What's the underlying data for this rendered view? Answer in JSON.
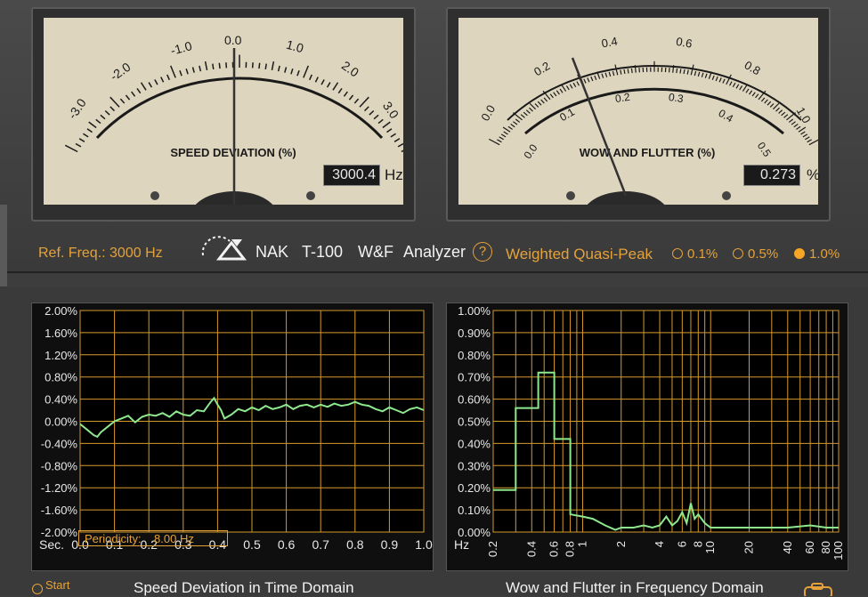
{
  "meters": {
    "speed": {
      "title": "SPEED DEVIATION (%)",
      "scale": [
        "-3.0",
        "-2.0",
        "-1.0",
        "0.0",
        "1.0",
        "2.0",
        "3.0"
      ],
      "readout": "3000.4",
      "unit": "Hz"
    },
    "wow": {
      "title": "WOW AND FLUTTER (%)",
      "outer_scale": [
        "0.0",
        "0.2",
        "0.4",
        "0.6",
        "0.8",
        "1.0"
      ],
      "inner_scale": [
        "0.0",
        "0.1",
        "0.2",
        "0.3",
        "0.4",
        "0.5"
      ],
      "readout": "0.273",
      "unit": "%"
    }
  },
  "control_bar": {
    "ref_freq": "Ref. Freq.: 3000 Hz",
    "brand_nak": "NAK",
    "brand_model": "T-100",
    "brand_wf": "W&F",
    "brand_analyzer": "Analyzer",
    "help": "?",
    "mode": "Weighted Quasi-Peak",
    "ranges": [
      {
        "label": "0.1%",
        "selected": false
      },
      {
        "label": "0.5%",
        "selected": false
      },
      {
        "label": "1.0%",
        "selected": true
      }
    ]
  },
  "bottom": {
    "start_label": "Start",
    "left_caption": "Speed Deviation in Time Domain",
    "right_caption": "Wow and Flutter in Frequency Domain",
    "periodicity_label": "Periodicity:",
    "periodicity_value": "8.00 Hz"
  },
  "chart_data": [
    {
      "type": "line",
      "y_ticks": [
        "2.00%",
        "1.60%",
        "1.20%",
        "0.80%",
        "0.40%",
        "0.00%",
        "-0.40%",
        "-0.80%",
        "-1.20%",
        "-1.60%",
        "-2.00%"
      ],
      "x_unit": "Sec.",
      "x_ticks": [
        "0.0",
        "0.1",
        "0.2",
        "0.3",
        "0.4",
        "0.5",
        "0.6",
        "0.7",
        "0.8",
        "0.9",
        "1.0"
      ],
      "ylim": [
        -2.0,
        2.0
      ],
      "xlim": [
        0.0,
        1.0
      ],
      "series": [
        {
          "color": "#8ee88e",
          "x": [
            0.0,
            0.02,
            0.04,
            0.05,
            0.06,
            0.08,
            0.1,
            0.12,
            0.14,
            0.16,
            0.18,
            0.2,
            0.22,
            0.24,
            0.26,
            0.28,
            0.3,
            0.32,
            0.34,
            0.36,
            0.38,
            0.39,
            0.4,
            0.41,
            0.42,
            0.44,
            0.46,
            0.48,
            0.5,
            0.52,
            0.54,
            0.56,
            0.58,
            0.6,
            0.62,
            0.64,
            0.66,
            0.68,
            0.7,
            0.72,
            0.74,
            0.76,
            0.78,
            0.8,
            0.82,
            0.84,
            0.86,
            0.88,
            0.9,
            0.92,
            0.94,
            0.96,
            0.98,
            1.0
          ],
          "y": [
            -0.05,
            -0.15,
            -0.25,
            -0.28,
            -0.2,
            -0.1,
            0.0,
            0.05,
            0.1,
            -0.02,
            0.08,
            0.12,
            0.1,
            0.15,
            0.08,
            0.18,
            0.12,
            0.1,
            0.2,
            0.18,
            0.35,
            0.42,
            0.3,
            0.2,
            0.05,
            0.12,
            0.22,
            0.18,
            0.25,
            0.2,
            0.28,
            0.22,
            0.25,
            0.3,
            0.22,
            0.28,
            0.3,
            0.25,
            0.3,
            0.26,
            0.32,
            0.28,
            0.3,
            0.35,
            0.3,
            0.28,
            0.22,
            0.18,
            0.25,
            0.2,
            0.15,
            0.22,
            0.25,
            0.2
          ]
        }
      ]
    },
    {
      "type": "line",
      "y_ticks": [
        "1.00%",
        "0.90%",
        "0.80%",
        "0.70%",
        "0.60%",
        "0.50%",
        "0.40%",
        "0.30%",
        "0.20%",
        "0.10%",
        "0.00%"
      ],
      "x_unit": "Hz",
      "x_ticks": [
        "0.2",
        "0.4",
        "0.6",
        "0.8",
        "1",
        "2",
        "4",
        "6",
        "8",
        "10",
        "20",
        "40",
        "60",
        "80",
        "100"
      ],
      "x_scale": "log",
      "ylim": [
        0.0,
        1.0
      ],
      "xlim": [
        0.2,
        100
      ],
      "series": [
        {
          "color": "#8ee88e",
          "x": [
            0.2,
            0.3,
            0.3,
            0.45,
            0.45,
            0.6,
            0.6,
            0.8,
            0.8,
            1.0,
            1.2,
            1.5,
            1.8,
            2.0,
            2.5,
            3.0,
            3.5,
            4.0,
            4.5,
            5.0,
            5.5,
            6.0,
            6.5,
            7.0,
            7.5,
            8.0,
            9.0,
            10.0,
            15,
            20,
            30,
            40,
            60,
            80,
            100
          ],
          "y": [
            0.19,
            0.19,
            0.56,
            0.56,
            0.72,
            0.72,
            0.42,
            0.42,
            0.08,
            0.07,
            0.06,
            0.03,
            0.01,
            0.02,
            0.02,
            0.03,
            0.02,
            0.03,
            0.07,
            0.03,
            0.05,
            0.09,
            0.04,
            0.13,
            0.06,
            0.08,
            0.04,
            0.02,
            0.02,
            0.02,
            0.02,
            0.02,
            0.03,
            0.02,
            0.02
          ]
        }
      ]
    }
  ]
}
